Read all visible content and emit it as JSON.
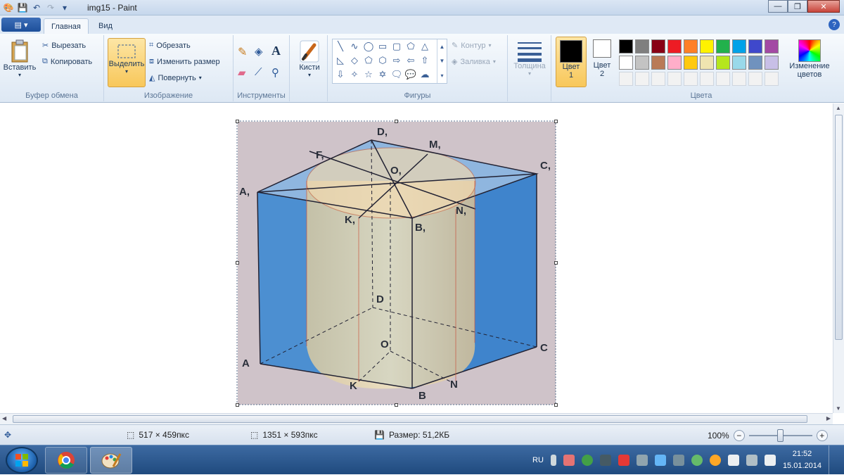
{
  "window": {
    "title": "img15 - Paint"
  },
  "tabs": [
    {
      "label": "Главная"
    },
    {
      "label": "Вид"
    }
  ],
  "ribbon": {
    "clipboard": {
      "label": "Буфер обмена",
      "paste": "Вставить",
      "cut": "Вырезать",
      "copy": "Копировать"
    },
    "image": {
      "label": "Изображение",
      "select": "Выделить",
      "crop": "Обрезать",
      "resize": "Изменить размер",
      "rotate": "Повернуть"
    },
    "tools": {
      "label": "Инструменты"
    },
    "brushes": {
      "label": "Кисти"
    },
    "shapes": {
      "label": "Фигуры",
      "outline": "Контур",
      "fill": "Заливка"
    },
    "size": {
      "label": "Толщина"
    },
    "color1": {
      "label": "Цвет",
      "sub": "1"
    },
    "color2": {
      "label": "Цвет",
      "sub": "2"
    },
    "colors": {
      "label": "Цвета",
      "edit": "Изменение",
      "edit2": "цветов",
      "palette_row1": [
        "#000000",
        "#7f7f7f",
        "#880015",
        "#ed1c24",
        "#ff7f27",
        "#fff200",
        "#22b14c",
        "#00a2e8",
        "#3f48cc",
        "#a349a4"
      ],
      "palette_row2": [
        "#ffffff",
        "#c3c3c3",
        "#b97a57",
        "#ffaec9",
        "#ffc90e",
        "#efe4b0",
        "#b5e61d",
        "#99d9ea",
        "#7092be",
        "#c8bfe7"
      ]
    }
  },
  "diagram": {
    "labels": {
      "D1": "D,",
      "M1": "M,",
      "F1": "F,",
      "O1": "O,",
      "C1": "C,",
      "A1": "A,",
      "N1": "N,",
      "K1": "K,",
      "B1": "B,",
      "D": "D",
      "O": "O",
      "C": "C",
      "A": "A",
      "K": "K",
      "N": "N",
      "B": "B"
    }
  },
  "status": {
    "selection": "517 × 459пкс",
    "image_size": "1351 × 593пкс",
    "file_size": "Размер: 51,2КБ",
    "zoom": "100%"
  },
  "taskbar": {
    "lang": "RU",
    "time": "21:52",
    "date": "15.01.2014"
  }
}
